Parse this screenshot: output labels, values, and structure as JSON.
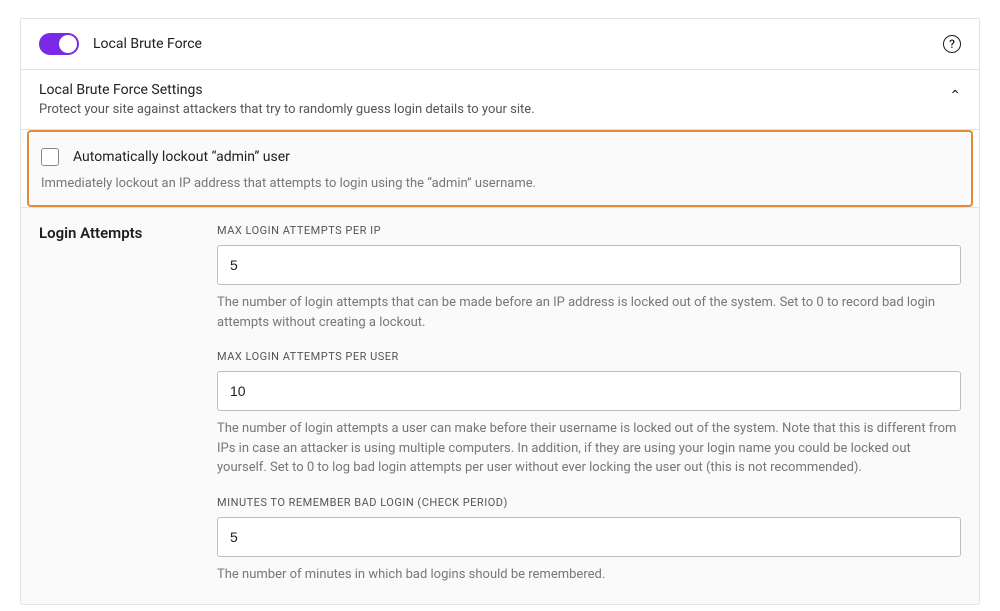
{
  "panel": {
    "title": "Local Brute Force",
    "help_glyph": "?"
  },
  "subsection": {
    "title": "Local Brute Force Settings",
    "description": "Protect your site against attackers that try to randomly guess login details to your site.",
    "chevron_glyph": "⌃"
  },
  "admin_lockout": {
    "label": "Automatically lockout “admin” user",
    "description": "Immediately lockout an IP address that attempts to login using the “admin” username."
  },
  "login_attempts": {
    "section_label": "Login Attempts",
    "max_per_ip": {
      "label": "MAX LOGIN ATTEMPTS PER IP",
      "value": "5",
      "help": "The number of login attempts that can be made before an IP address is locked out of the system. Set to 0 to record bad login attempts without creating a lockout."
    },
    "max_per_user": {
      "label": "MAX LOGIN ATTEMPTS PER USER",
      "value": "10",
      "help": "The number of login attempts a user can make before their username is locked out of the system. Note that this is different from IPs in case an attacker is using multiple computers. In addition, if they are using your login name you could be locked out yourself. Set to 0 to log bad login attempts per user without ever locking the user out (this is not recommended)."
    },
    "check_period": {
      "label": "MINUTES TO REMEMBER BAD LOGIN (CHECK PERIOD)",
      "value": "5",
      "help": "The number of minutes in which bad logins should be remembered."
    }
  }
}
